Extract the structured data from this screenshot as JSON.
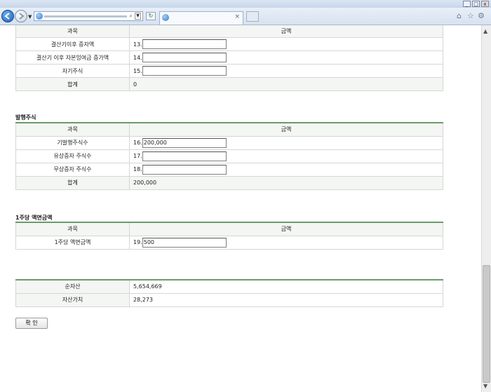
{
  "browser": {
    "window_controls": {
      "minimize": "_",
      "maximize": "□",
      "close": "x"
    },
    "tab_close": "×",
    "address_search_glyph": "⌕",
    "icons": [
      "back-icon",
      "forward-icon",
      "refresh-icon",
      "home-icon",
      "star-icon",
      "gear-icon"
    ]
  },
  "table1": {
    "header": {
      "subject": "과목",
      "amount": "금액"
    },
    "rows": [
      {
        "label": "결산기이후 증자액",
        "num": "13.",
        "value": ""
      },
      {
        "label": "결산기 이후 자본잉여금 증가액",
        "num": "14.",
        "value": ""
      },
      {
        "label": "자기주식",
        "num": "15.",
        "value": ""
      }
    ],
    "total": {
      "label": "합계",
      "value": "0"
    }
  },
  "section2": {
    "title": "발행주식",
    "header": {
      "subject": "과목",
      "amount": "금액"
    },
    "rows": [
      {
        "label": "기발행주식수",
        "num": "16.",
        "value": "200,000"
      },
      {
        "label": "유상증자 주식수",
        "num": "17.",
        "value": ""
      },
      {
        "label": "무상증자 주식수",
        "num": "18.",
        "value": ""
      }
    ],
    "total": {
      "label": "합계",
      "value": "200,000"
    }
  },
  "section3": {
    "title": "1주당 액면금액",
    "header": {
      "subject": "과목",
      "amount": "금액"
    },
    "rows": [
      {
        "label": "1주당 액면금액",
        "num": "19.",
        "value": "500"
      }
    ]
  },
  "summary": {
    "rows": [
      {
        "label": "순자산",
        "value": "5,654,669"
      },
      {
        "label": "자산가치",
        "value": "28,273"
      }
    ]
  },
  "confirm_label": "확 인"
}
